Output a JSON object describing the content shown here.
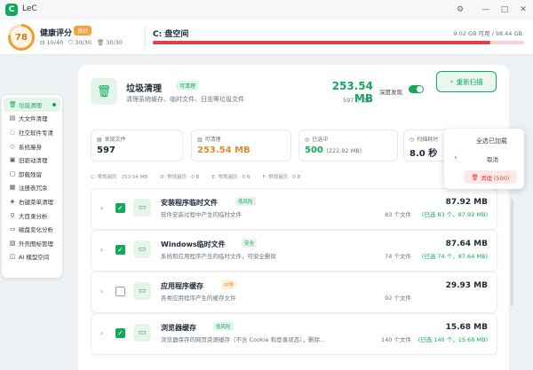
{
  "app": {
    "logo": "C",
    "title": "LeC"
  },
  "window": {
    "settings_icon": "gear-icon",
    "minimize": "—",
    "maximize": "□",
    "close": "✕"
  },
  "health": {
    "score": "78",
    "title": "健康评分",
    "badge": "良好",
    "stats": [
      "10/40",
      "30/30",
      "30/30"
    ],
    "ring_color": "#f29b2f"
  },
  "disk": {
    "title": "C: 盘空间",
    "usage": "9.02 GB 可用 / 98.44 GB",
    "used_fraction": 0.91,
    "bar_color": "#e0403f"
  },
  "sidebar": {
    "items": [
      {
        "label": "垃圾清理",
        "icon": "trash-icon",
        "active": true
      },
      {
        "label": "大文件清理",
        "icon": "file-icon"
      },
      {
        "label": "社交软件专清",
        "icon": "chat-icon"
      },
      {
        "label": "系统瘦身",
        "icon": "diamond-icon"
      },
      {
        "label": "旧驱动清理",
        "icon": "driver-icon"
      },
      {
        "label": "卸载残留",
        "icon": "uninstall-icon"
      },
      {
        "label": "注册表冗余",
        "icon": "registry-icon"
      },
      {
        "label": "右键菜单清理",
        "icon": "menu-icon"
      },
      {
        "label": "大目录分析",
        "icon": "folder-tree-icon"
      },
      {
        "label": "磁盘变化分析",
        "icon": "disk-icon"
      },
      {
        "label": "外壳图标管理",
        "icon": "shell-icon"
      },
      {
        "label": "AI 模型空间",
        "icon": "ai-icon"
      }
    ]
  },
  "hero": {
    "title": "垃圾清理",
    "badge": "可清理",
    "desc": "清理系统缓存、临时文件、日志等垃圾文件",
    "size": "253.54 MB",
    "count": "597 个文件",
    "deep_label": "深度发现",
    "rescan_label": "重新扫描"
  },
  "stats": [
    {
      "label": "发现文件",
      "value": "597",
      "sub": "",
      "icon": "file-icon",
      "color": "#1f2a37"
    },
    {
      "label": "可清理",
      "value": "253.54 MB",
      "sub": "",
      "icon": "clean-icon",
      "color": "#e28a2a"
    },
    {
      "label": "已选中",
      "value": "500",
      "sub": "(222.92 MB)",
      "icon": "check-icon",
      "color": "#14a85c"
    },
    {
      "label": "扫描耗时",
      "value": "8.0 秒",
      "sub": "",
      "icon": "clock-icon",
      "color": "#1f2a37"
    }
  ],
  "drives": [
    "C: 常规遍历 · 253.54 MB",
    "D: 常规遍历 · 0 B",
    "E: 常规遍历 · 0 B",
    "F: 常规遍历 · 0 B"
  ],
  "rows": [
    {
      "title": "安装程序临时文件",
      "risk": "低风险",
      "risk_type": "low",
      "checked": true,
      "desc": "软件安装过程中产生的临时文件",
      "count": "83 个文件",
      "size": "87.92 MB",
      "selected": "(已选 83 个，87.92 MB)"
    },
    {
      "title": "Windows临时文件",
      "risk": "安全",
      "risk_type": "safe",
      "checked": true,
      "desc": "系统和应用程序产生的临时文件，可安全删除",
      "count": "74 个文件",
      "size": "87.64 MB",
      "selected": "(已选 74 个，87.64 MB)"
    },
    {
      "title": "应用程序缓存",
      "risk": "中等",
      "risk_type": "mid",
      "checked": false,
      "desc": "各类应用程序产生的缓存文件",
      "count": "92 个文件",
      "size": "29.93 MB",
      "selected": ""
    },
    {
      "title": "浏览器缓存",
      "risk": "低风险",
      "risk_type": "low",
      "checked": true,
      "desc": "浏览器保存的网页资源缓存（不含 Cookie 和登录状态），删除...",
      "count": "140 个文件",
      "size": "15.68 MB",
      "selected": "(已选 140 个，15.68 MB)"
    }
  ],
  "popup": {
    "select_all": "全选已加载",
    "cancel": "取消",
    "clean": "清理 (500)"
  }
}
